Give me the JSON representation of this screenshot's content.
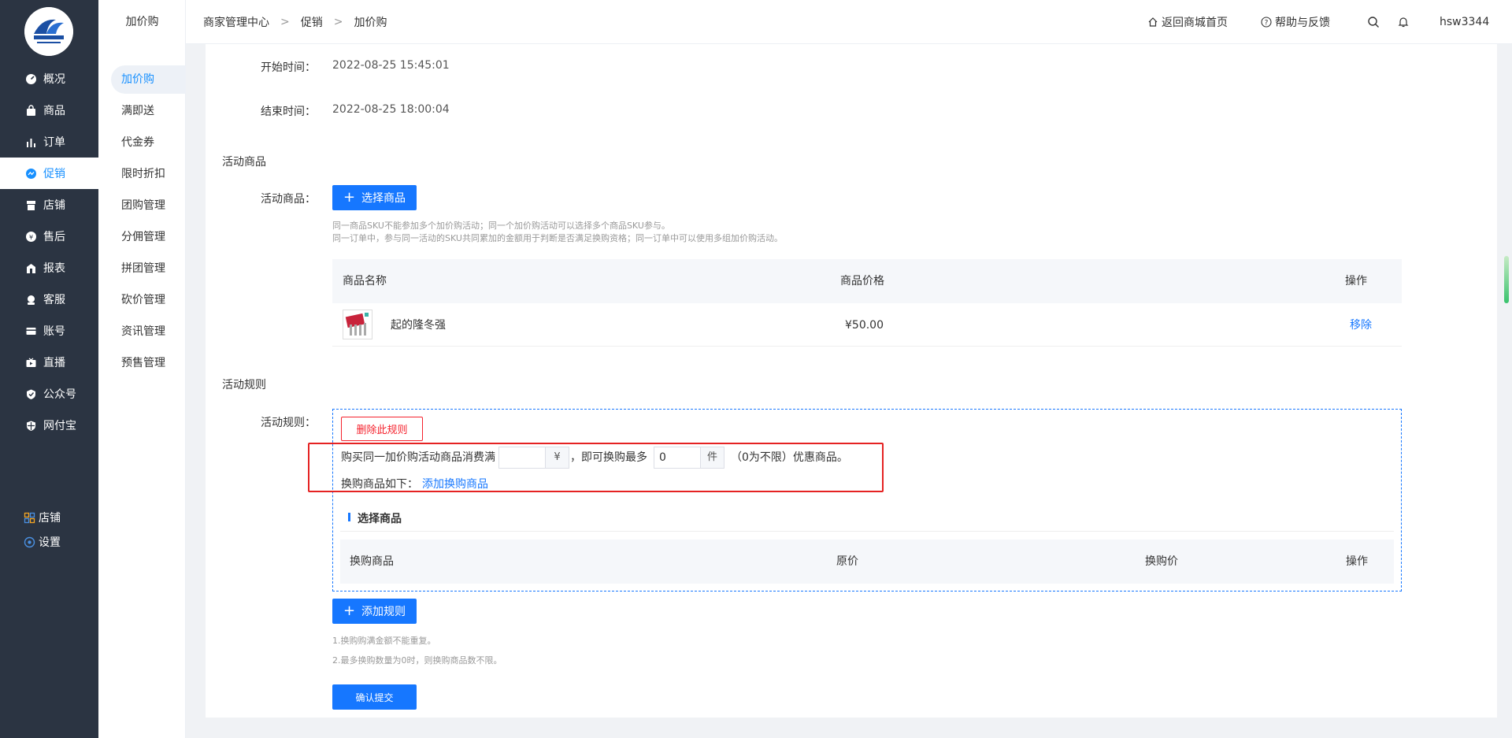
{
  "sidebar": {
    "items": [
      {
        "label": "概况",
        "icon": "dashboard-icon"
      },
      {
        "label": "商品",
        "icon": "bag-icon"
      },
      {
        "label": "订单",
        "icon": "bar-chart-icon"
      },
      {
        "label": "促销",
        "icon": "promo-icon"
      },
      {
        "label": "店铺",
        "icon": "store-icon"
      },
      {
        "label": "售后",
        "icon": "after-sale-icon"
      },
      {
        "label": "报表",
        "icon": "report-icon"
      },
      {
        "label": "客服",
        "icon": "service-icon"
      },
      {
        "label": "账号",
        "icon": "card-icon"
      },
      {
        "label": "直播",
        "icon": "live-icon"
      },
      {
        "label": "公众号",
        "icon": "wechat-icon"
      },
      {
        "label": "网付宝",
        "icon": "shield-icon"
      }
    ],
    "bottom": [
      {
        "label": "店铺",
        "icon": "grid-icon"
      },
      {
        "label": "设置",
        "icon": "settings-icon"
      }
    ],
    "active_index": 3
  },
  "subbar": {
    "title": "加价购",
    "items": [
      "加价购",
      "满即送",
      "代金券",
      "限时折扣",
      "团购管理",
      "分佣管理",
      "拼团管理",
      "砍价管理",
      "资讯管理",
      "预售管理"
    ]
  },
  "header": {
    "breadcrumb": [
      "商家管理中心",
      "促销",
      "加价购"
    ],
    "back_home": "返回商城首页",
    "help": "帮助与反馈",
    "username": "hsw3344"
  },
  "form": {
    "start_label": "开始时间：",
    "start_value": "2022-08-25 15:45:01",
    "end_label": "结束时间：",
    "end_value": "2022-08-25 18:00:04",
    "goods_section": "活动商品",
    "goods_label": "活动商品：",
    "select_goods_btn": "选择商品",
    "hint1": "同一商品SKU不能参加多个加价购活动；同一个加价购活动可以选择多个商品SKU参与。",
    "hint2": "同一订单中，参与同一活动的SKU共同累加的金额用于判断是否满足换购资格；同一订单中可以使用多组加价购活动。",
    "goods_table": {
      "headers": [
        "商品名称",
        "商品价格",
        "操作"
      ],
      "rows": [
        {
          "name": "起的隆冬强",
          "price": "¥50.00",
          "action": "移除"
        }
      ]
    },
    "rule_section": "活动规则",
    "rule_label": "活动规则：",
    "delete_rule_btn": "删除此规则",
    "rule_text_before": "购买同一加价购活动商品消费满",
    "amount_value": "",
    "currency_addon": "¥",
    "rule_text_mid": "，即可换购最多",
    "max_qty_value": "0",
    "qty_addon": "件",
    "rule_text_after": "（0为不限）优惠商品。",
    "exchange_label": "换购商品如下：",
    "add_exchange_link": "添加换购商品",
    "select_goods_title": "选择商品",
    "exchange_table_headers": [
      "换购商品",
      "原价",
      "换购价",
      "操作"
    ],
    "add_rule_btn": "添加规则",
    "note1": "1.换购购满金额不能重复。",
    "note2": "2.最多换购数量为0时，则换购商品数不限。",
    "submit_btn": "确认提交"
  },
  "colors": {
    "sidebar_bg": "#2b3442",
    "primary": "#1677ff",
    "highlight_red": "#e52222"
  }
}
